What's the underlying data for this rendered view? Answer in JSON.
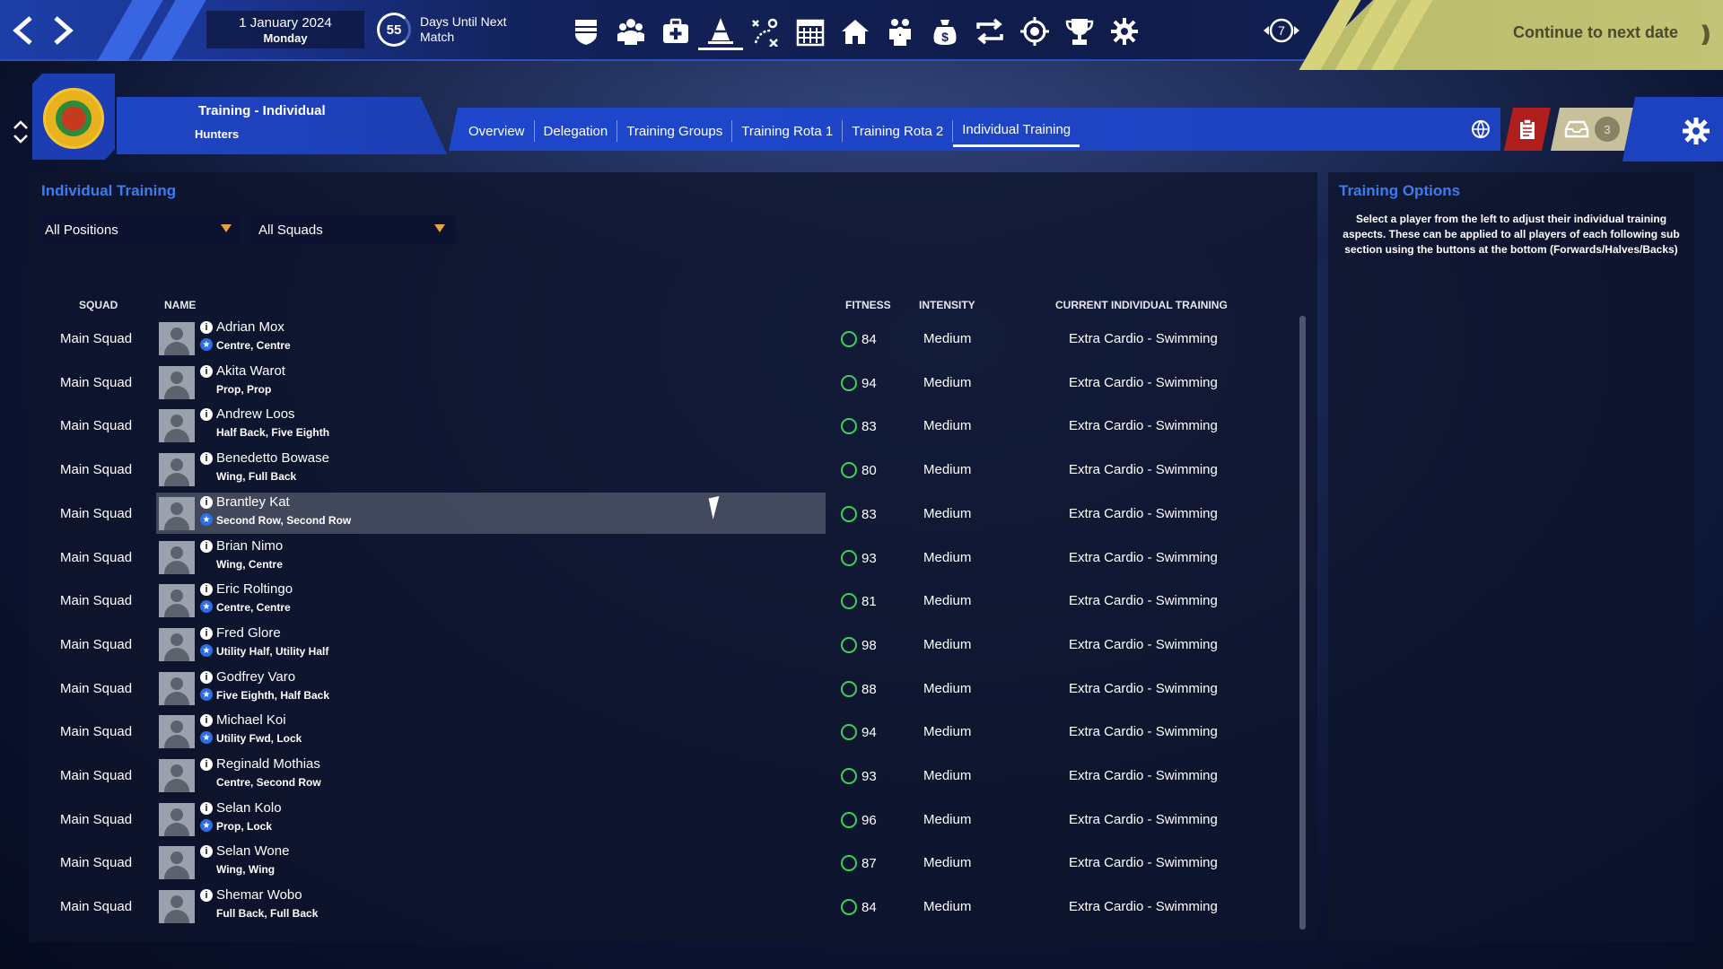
{
  "topbar": {
    "date": "1 January 2024",
    "weekday": "Monday",
    "days_count": "55",
    "days_label_line1": "Days Until Next",
    "days_label_line2": "Match",
    "icons": [
      "shield-icon",
      "squad-icon",
      "medical-icon",
      "training-cone-icon",
      "tactics-icon",
      "calendar-icon",
      "home-icon",
      "staff-icon",
      "finances-icon",
      "transfers-icon",
      "scouting-icon",
      "trophy-icon",
      "club-settings-icon"
    ],
    "active_icon": "training-cone-icon",
    "clock_number": "7",
    "continue_label": "Continue to next date"
  },
  "header": {
    "title": "Training - Individual",
    "subtitle": "Hunters",
    "tabs": [
      {
        "label": "Overview"
      },
      {
        "label": "Delegation"
      },
      {
        "label": "Training Groups"
      },
      {
        "label": "Training Rota 1"
      },
      {
        "label": "Training Rota 2"
      },
      {
        "label": "Individual Training",
        "active": true
      }
    ],
    "message_count": "3"
  },
  "main": {
    "title": "Individual Training",
    "filter_positions": "All Positions",
    "filter_squads": "All Squads",
    "columns": {
      "squad": "SQUAD",
      "name": "NAME",
      "fitness": "FITNESS",
      "intensity": "INTENSITY",
      "training": "CURRENT INDIVIDUAL TRAINING"
    },
    "players": [
      {
        "squad": "Main Squad",
        "name": "Adrian Mox",
        "positions": "Centre, Centre",
        "star": true,
        "fitness": "84",
        "intensity": "Medium",
        "training": "Extra Cardio - Swimming"
      },
      {
        "squad": "Main Squad",
        "name": "Akita Warot",
        "positions": "Prop, Prop",
        "star": false,
        "fitness": "94",
        "intensity": "Medium",
        "training": "Extra Cardio - Swimming"
      },
      {
        "squad": "Main Squad",
        "name": "Andrew Loos",
        "positions": "Half Back, Five Eighth",
        "star": false,
        "fitness": "83",
        "intensity": "Medium",
        "training": "Extra Cardio - Swimming"
      },
      {
        "squad": "Main Squad",
        "name": "Benedetto Bowase",
        "positions": "Wing, Full Back",
        "star": false,
        "fitness": "80",
        "intensity": "Medium",
        "training": "Extra Cardio - Swimming"
      },
      {
        "squad": "Main Squad",
        "name": "Brantley Kat",
        "positions": "Second Row, Second Row",
        "star": true,
        "fitness": "83",
        "intensity": "Medium",
        "training": "Extra Cardio - Swimming",
        "highlighted": true
      },
      {
        "squad": "Main Squad",
        "name": "Brian Nimo",
        "positions": "Wing, Centre",
        "star": false,
        "fitness": "93",
        "intensity": "Medium",
        "training": "Extra Cardio - Swimming"
      },
      {
        "squad": "Main Squad",
        "name": "Eric Roltingo",
        "positions": "Centre, Centre",
        "star": true,
        "fitness": "81",
        "intensity": "Medium",
        "training": "Extra Cardio - Swimming"
      },
      {
        "squad": "Main Squad",
        "name": "Fred Glore",
        "positions": "Utility Half, Utility Half",
        "star": true,
        "fitness": "98",
        "intensity": "Medium",
        "training": "Extra Cardio - Swimming"
      },
      {
        "squad": "Main Squad",
        "name": "Godfrey Varo",
        "positions": "Five Eighth, Half Back",
        "star": true,
        "fitness": "88",
        "intensity": "Medium",
        "training": "Extra Cardio - Swimming"
      },
      {
        "squad": "Main Squad",
        "name": "Michael Koi",
        "positions": "Utility Fwd, Lock",
        "star": true,
        "fitness": "94",
        "intensity": "Medium",
        "training": "Extra Cardio - Swimming"
      },
      {
        "squad": "Main Squad",
        "name": "Reginald Mothias",
        "positions": "Centre, Second Row",
        "star": false,
        "fitness": "93",
        "intensity": "Medium",
        "training": "Extra Cardio - Swimming"
      },
      {
        "squad": "Main Squad",
        "name": "Selan Kolo",
        "positions": "Prop, Lock",
        "star": true,
        "fitness": "96",
        "intensity": "Medium",
        "training": "Extra Cardio - Swimming"
      },
      {
        "squad": "Main Squad",
        "name": "Selan Wone",
        "positions": "Wing, Wing",
        "star": false,
        "fitness": "87",
        "intensity": "Medium",
        "training": "Extra Cardio - Swimming"
      },
      {
        "squad": "Main Squad",
        "name": "Shemar Wobo",
        "positions": "Full Back, Full Back",
        "star": false,
        "fitness": "84",
        "intensity": "Medium",
        "training": "Extra Cardio - Swimming"
      }
    ]
  },
  "sidebar": {
    "title": "Training Options",
    "text": "Select a player from the left to adjust their individual training aspects. These can be applied to all players of each following sub section using the buttons at the bottom (Forwards/Halves/Backs)"
  },
  "colors": {
    "accent_blue": "#1e45c4",
    "title_blue": "#3d7bf2",
    "continue_bg": "#c3c376",
    "fitness_green": "#3fd05a",
    "alert_red": "#b01e1e"
  }
}
